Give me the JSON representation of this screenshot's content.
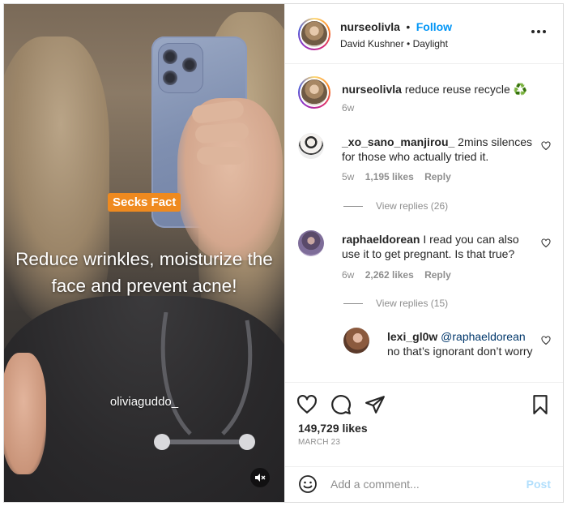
{
  "media": {
    "sticker": "Secks Fact",
    "caption": "Reduce wrinkles, moisturize the face and prevent acne!",
    "watermark": "oliviaɡuddo_",
    "mute_icon": "speaker-muted-icon"
  },
  "header": {
    "username": "nurseolivla",
    "separator": "•",
    "follow_label": "Follow",
    "audio": "David Kushner • Daylight",
    "more_icon": "more-options-icon"
  },
  "caption": {
    "username": "nurseolivla",
    "text": "reduce reuse recycle ♻️",
    "age": "6w"
  },
  "comments": [
    {
      "username": "_xo_sano_manjirou_",
      "text": "2mins silences for those who actually tried it.",
      "age": "5w",
      "likes": "1,195 likes",
      "reply_label": "Reply",
      "view_replies": "View replies (26)"
    },
    {
      "username": "raphaeldorean",
      "text": "I read you can also use it to get pregnant. Is that true?",
      "age": "6w",
      "likes": "2,262 likes",
      "reply_label": "Reply",
      "view_replies": "View replies (15)"
    }
  ],
  "reply": {
    "username": "lexi_gl0w",
    "mention": "@raphaeldorean",
    "text": "no that’s ignorant don’t worry"
  },
  "actions": {
    "likes": "149,729 likes",
    "date": "MARCH 23"
  },
  "add_comment": {
    "placeholder": "Add a comment...",
    "post_label": "Post"
  },
  "colors": {
    "accent": "#0095f6",
    "sticker": "#ef8a1f",
    "muted": "#8e8e8e"
  }
}
